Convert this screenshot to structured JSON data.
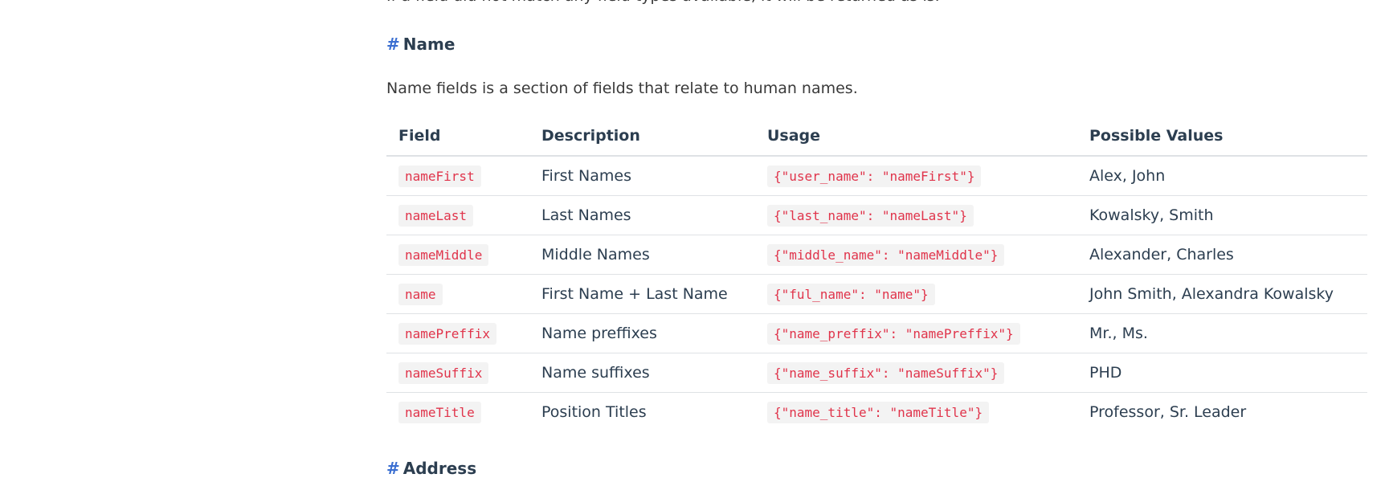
{
  "top_paragraph": "If a field did not match any field types available, it will be returned as is.",
  "name_section": {
    "anchor": "#",
    "title": "Name",
    "intro": "Name fields is a section of fields that relate to human names."
  },
  "table": {
    "headers": [
      "Field",
      "Description",
      "Usage",
      "Possible Values"
    ],
    "rows": [
      {
        "field": "nameFirst",
        "description": "First Names",
        "usage": "{\"user_name\": \"nameFirst\"}",
        "values": "Alex, John"
      },
      {
        "field": "nameLast",
        "description": "Last Names",
        "usage": "{\"last_name\": \"nameLast\"}",
        "values": "Kowalsky, Smith"
      },
      {
        "field": "nameMiddle",
        "description": "Middle Names",
        "usage": "{\"middle_name\": \"nameMiddle\"}",
        "values": "Alexander, Charles"
      },
      {
        "field": "name",
        "description": "First Name + Last Name",
        "usage": "{\"ful_name\": \"name\"}",
        "values": "John Smith, Alexandra Kowalsky"
      },
      {
        "field": "namePreffix",
        "description": "Name preffixes",
        "usage": "{\"name_preffix\": \"namePreffix\"}",
        "values": "Mr., Ms."
      },
      {
        "field": "nameSuffix",
        "description": "Name suffixes",
        "usage": "{\"name_suffix\": \"nameSuffix\"}",
        "values": "PHD"
      },
      {
        "field": "nameTitle",
        "description": "Position Titles",
        "usage": "{\"name_title\": \"nameTitle\"}",
        "values": "Professor, Sr. Leader"
      }
    ]
  },
  "address_section": {
    "anchor": "#",
    "title": "Address"
  }
}
